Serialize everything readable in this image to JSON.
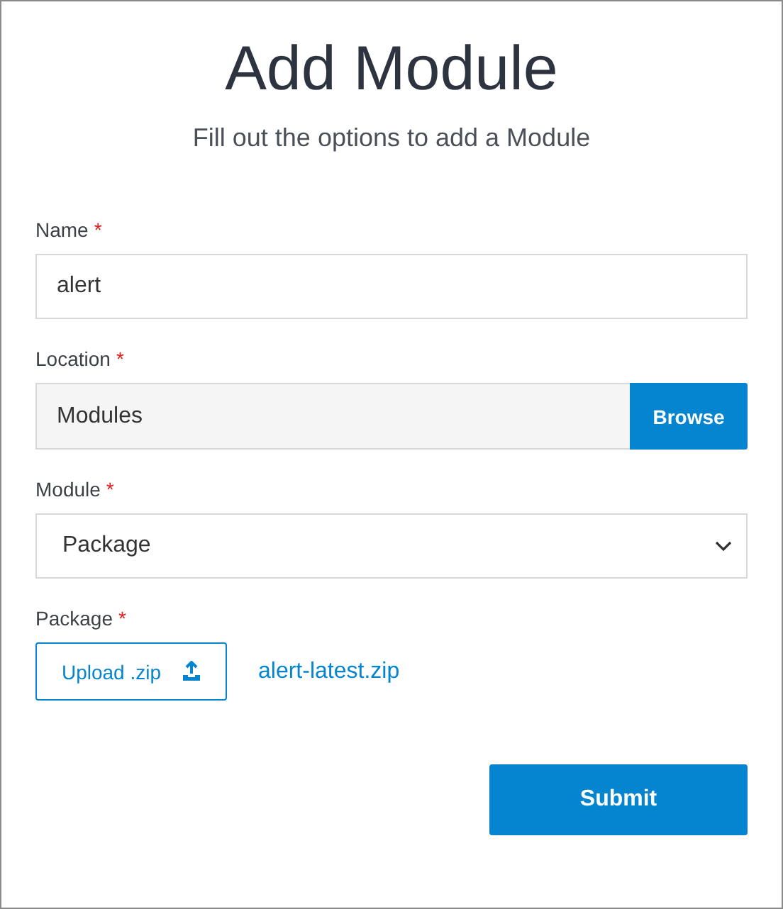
{
  "title": "Add Module",
  "subtitle": "Fill out the options to add a Module",
  "fields": [
    {
      "kind": "text",
      "label": "Name",
      "required_mark": "*",
      "value": "alert"
    },
    {
      "kind": "browse",
      "label": "Location",
      "required_mark": "*",
      "value": "Modules",
      "button": "Browse"
    },
    {
      "kind": "select",
      "label": "Module",
      "required_mark": "*",
      "value": "Package"
    },
    {
      "kind": "upload",
      "label": "Package",
      "required_mark": "*",
      "button": "Upload .zip",
      "file": "alert-latest.zip"
    }
  ],
  "submit": "Submit"
}
